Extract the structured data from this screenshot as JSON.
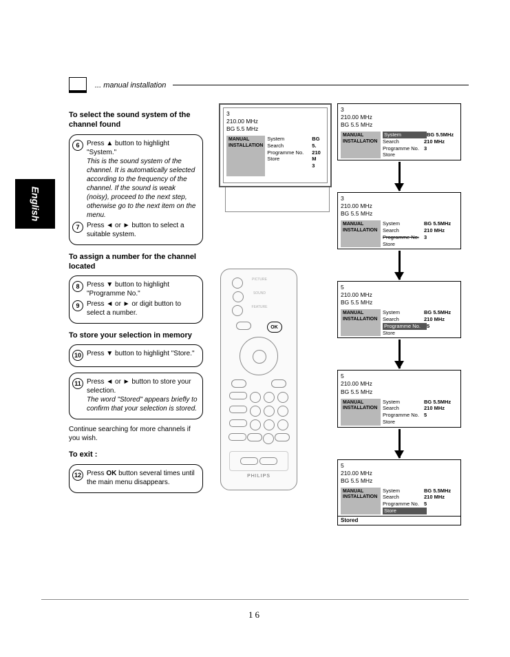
{
  "header": {
    "title": "... manual installation"
  },
  "lang": "English",
  "sections": {
    "s1": {
      "head": "To select the sound system of the channel found",
      "step6_pre": "Press ",
      "step6_mid": " button to highlight \"System.\"",
      "step6_italic": "This is the sound system of the channel. It is automatically selected according to the frequency of the channel. If the sound is weak (noisy), proceed to the next step, otherwise go to the next item on the menu.",
      "step7": "Press ◄ or ► button to select a suitable system."
    },
    "s2": {
      "head": "To assign a number for the channel located",
      "step8": "Press ▼ button to highlight \"Programme No.\"",
      "step9": "Press ◄ or ► or digit button to select a number."
    },
    "s3": {
      "head": "To store your selection in memory",
      "step10": "Press ▼ button to highlight \"Store.\"",
      "step11": "Press ◄ or ► button to store your selection.",
      "step11_italic": "The word \"Stored\" appears briefly to confirm that your selection is stored."
    },
    "continue": "Continue searching for more channels if you wish.",
    "s4": {
      "head": "To exit :",
      "step12a": "Press ",
      "step12_ok": "OK",
      "step12b": " button several times until the main menu disappears."
    }
  },
  "osd": {
    "title1": "MANUAL",
    "title2": "INSTALLATION",
    "m_system": "System",
    "m_search": "Search",
    "m_prog": "Programme No.",
    "m_store": "Store",
    "stored": "Stored",
    "bg55mhz": "BG 5.5MHz",
    "mhz210": "210 MHz",
    "mhz210M": "210 M",
    "bg5": "BG 5."
  },
  "screens": {
    "ch3": "3",
    "ch5": "5",
    "freq": "210.00 MHz",
    "snd": "BG 5.5 MHz",
    "pn3": "3",
    "pn5": "5"
  },
  "remote": {
    "brand": "PHILIPS",
    "ok": "OK",
    "labels": {
      "picture": "PICTURE",
      "sound": "SOUND",
      "feature": "FEATURE"
    }
  },
  "pageNumber": "16"
}
